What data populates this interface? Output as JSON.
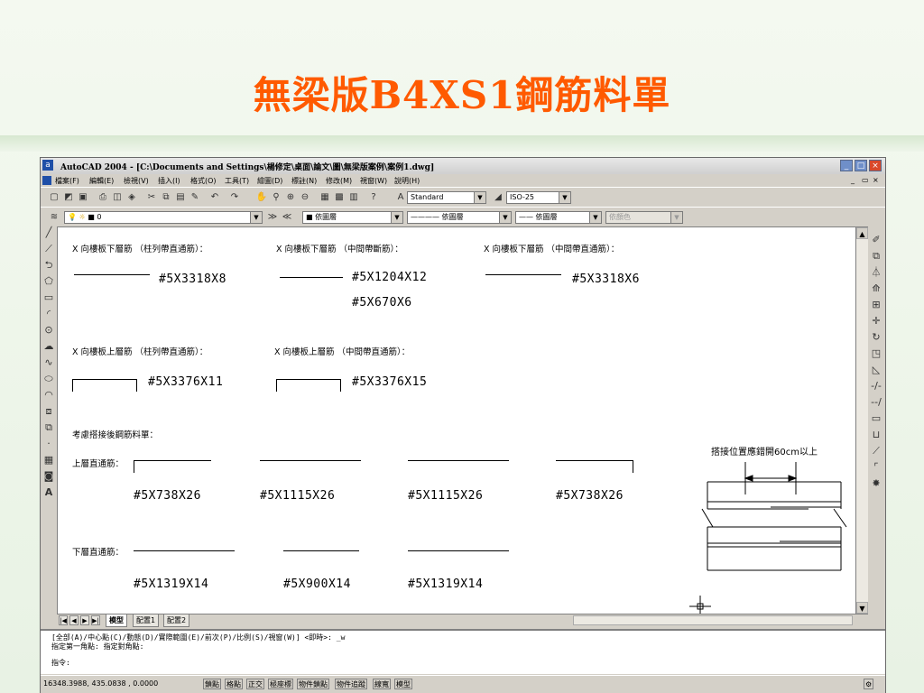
{
  "slide": {
    "title": "無梁版B4XS1鋼筋料單"
  },
  "window": {
    "title": "AutoCAD 2004 - [C:\\Documents and Settings\\楊修定\\桌面\\論文\\圖\\無梁版案例\\案例1.dwg]",
    "controls": [
      "_",
      "□",
      "×"
    ]
  },
  "menu": [
    "檔案(F)",
    "編輯(E)",
    "檢視(V)",
    "插入(I)",
    "格式(O)",
    "工具(T)",
    "繪圖(D)",
    "標註(N)",
    "修改(M)",
    "視窗(W)",
    "說明(H)"
  ],
  "toolbar": {
    "text_style": "Standard",
    "dim_style": "ISO-25",
    "layer": "0",
    "color": "■ 依圖層",
    "linetype": "———— 依圖層",
    "lineweight": "—— 依圖層",
    "plotstyle": "依顏色"
  },
  "drawing": {
    "bottom_x_col": {
      "header": "X 向樓板下層筋 （柱列帶直通筋）：",
      "value": "#5X3318X8"
    },
    "bottom_x_mid_cut": {
      "header": "X 向樓板下層筋 （中間帶斷筋）：",
      "values": [
        "#5X1204X12",
        "#5X670X6"
      ]
    },
    "bottom_x_mid_through": {
      "header": "X 向樓板下層筋 （中間帶直通筋）：",
      "value": "#5X3318X6"
    },
    "top_x_col": {
      "header": "X 向樓板上層筋 （柱列帶直通筋）：",
      "value": "#5X3376X11"
    },
    "top_x_mid": {
      "header": "X 向樓板上層筋 （中間帶直通筋）：",
      "value": "#5X3376X15"
    },
    "splice_title": "考慮搭接後鋼筋料單：",
    "upper_label": "上層直通筋：",
    "upper_values": [
      "#5X738X26",
      "#5X1115X26",
      "#5X1115X26",
      "#5X738X26"
    ],
    "lower_label": "下層直通筋：",
    "lower_values": [
      "#5X1319X14",
      "#5X900X14",
      "#5X1319X14"
    ],
    "splice_note": "搭接位置應錯開60cm以上"
  },
  "tabs": [
    "模型",
    "配置1",
    "配置2"
  ],
  "command": {
    "line1": "[全部(A)/中心點(C)/動態(D)/實際範圍(E)/前次(P)/比例(S)/視窗(W)] <即時>: _w",
    "line2": "指定第一角點: 指定對角點:",
    "line3": "指令:"
  },
  "status": {
    "coords": "16348.3988, 435.0838 , 0.0000",
    "buttons": [
      "鎖點",
      "格點",
      "正交",
      "極座標",
      "物件鎖點",
      "物件追蹤",
      "線寬",
      "模型"
    ]
  },
  "icons": {
    "left": [
      "line-icon",
      "construction-line-icon",
      "polyline-icon",
      "polygon-icon",
      "rectangle-icon",
      "arc-icon",
      "circle-icon",
      "revision-cloud-icon",
      "spline-icon",
      "ellipse-icon",
      "ellipse-arc-icon",
      "insert-block-icon",
      "make-block-icon",
      "point-icon",
      "hatch-icon",
      "region-icon",
      "multiline-text-icon"
    ],
    "right": [
      "erase-icon",
      "copy-icon",
      "mirror-icon",
      "offset-icon",
      "array-icon",
      "move-icon",
      "rotate-icon",
      "scale-icon",
      "stretch-icon",
      "trim-icon",
      "extend-icon",
      "break-icon",
      "break-at-point-icon",
      "join-icon",
      "chamfer-icon",
      "fillet-icon",
      "explode-icon"
    ]
  }
}
